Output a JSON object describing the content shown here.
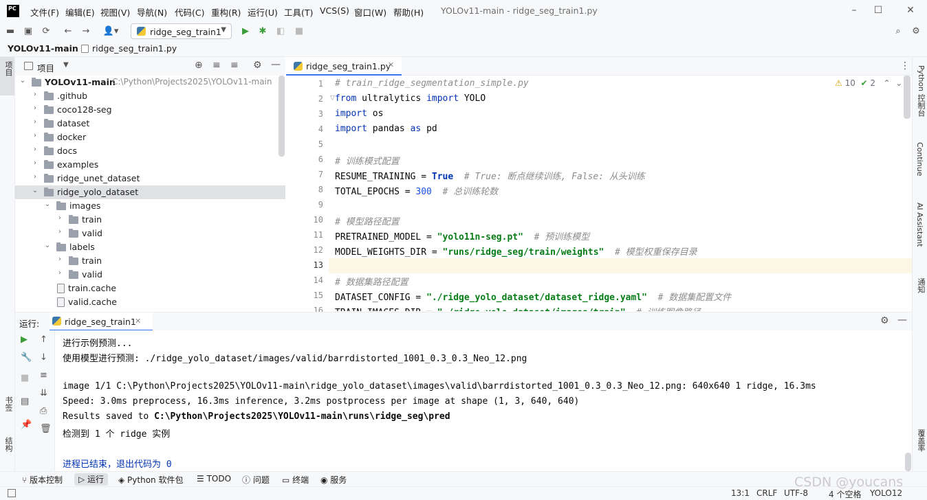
{
  "titlebar": {
    "logo_text": "PC",
    "menus": [
      "文件(F)",
      "编辑(E)",
      "视图(V)",
      "导航(N)",
      "代码(C)",
      "重构(R)",
      "运行(U)",
      "工具(T)",
      "VCS(S)",
      "窗口(W)",
      "帮助(H)"
    ],
    "window_title": "YOLOv11-main - ridge_seg_train1.py",
    "controls": [
      "–",
      "☐",
      "✕"
    ]
  },
  "toolbar": {
    "run_config": "ridge_seg_train1"
  },
  "breadcrumb": {
    "project": "YOLOv11-main",
    "file": "ridge_seg_train1.py"
  },
  "left_strip": {
    "project_label": "项目",
    "bookmarks_label": "书签",
    "structure_label": "结构"
  },
  "right_strip": {
    "python_console": "Python 控制台",
    "continue": "Continue",
    "ai_assistant": "AI Assistant",
    "notifications": "通知",
    "coverage": "覆盖率"
  },
  "project_panel": {
    "title": "项目",
    "root_name": "YOLOv11-main",
    "root_path": "C:\\Python\\Projects2025\\YOLOv11-main",
    "items": [
      {
        "name": ".github",
        "depth": 1,
        "type": "folder",
        "expanded": false
      },
      {
        "name": "coco128-seg",
        "depth": 1,
        "type": "folder",
        "expanded": false
      },
      {
        "name": "dataset",
        "depth": 1,
        "type": "folder",
        "expanded": false
      },
      {
        "name": "docker",
        "depth": 1,
        "type": "folder",
        "expanded": false
      },
      {
        "name": "docs",
        "depth": 1,
        "type": "folder",
        "expanded": false
      },
      {
        "name": "examples",
        "depth": 1,
        "type": "folder",
        "expanded": false
      },
      {
        "name": "ridge_unet_dataset",
        "depth": 1,
        "type": "folder",
        "expanded": false
      },
      {
        "name": "ridge_yolo_dataset",
        "depth": 1,
        "type": "folder",
        "expanded": true,
        "selected": true
      },
      {
        "name": "images",
        "depth": 2,
        "type": "folder",
        "expanded": true
      },
      {
        "name": "train",
        "depth": 3,
        "type": "folder",
        "expanded": false
      },
      {
        "name": "valid",
        "depth": 3,
        "type": "folder",
        "expanded": false
      },
      {
        "name": "labels",
        "depth": 2,
        "type": "folder",
        "expanded": true
      },
      {
        "name": "train",
        "depth": 3,
        "type": "folder",
        "expanded": false
      },
      {
        "name": "valid",
        "depth": 3,
        "type": "folder",
        "expanded": false
      },
      {
        "name": "train.cache",
        "depth": 3,
        "type": "file"
      },
      {
        "name": "valid.cache",
        "depth": 3,
        "type": "file"
      }
    ]
  },
  "editor": {
    "tab_label": "ridge_seg_train1.py",
    "warnings": "10",
    "checks": "2",
    "current_line": 13,
    "lines": [
      [
        {
          "t": "# train_ridge_segmentation_simple.py",
          "c": "cm"
        }
      ],
      [
        {
          "t": "from",
          "c": "kw"
        },
        {
          "t": " ultralytics ",
          "c": ""
        },
        {
          "t": "import",
          "c": "kw"
        },
        {
          "t": " YOLO",
          "c": ""
        }
      ],
      [
        {
          "t": "import",
          "c": "kw"
        },
        {
          "t": " os",
          "c": ""
        }
      ],
      [
        {
          "t": "import",
          "c": "kw"
        },
        {
          "t": " pandas ",
          "c": ""
        },
        {
          "t": "as",
          "c": "kw"
        },
        {
          "t": " pd",
          "c": ""
        }
      ],
      [],
      [
        {
          "t": "# 训练模式配置",
          "c": "cm"
        }
      ],
      [
        {
          "t": "RESUME_TRAINING = ",
          "c": ""
        },
        {
          "t": "True",
          "c": "bool"
        },
        {
          "t": "  # True: 断点继续训练, False: 从头训练",
          "c": "cm"
        }
      ],
      [
        {
          "t": "TOTAL_EPOCHS = ",
          "c": ""
        },
        {
          "t": "300",
          "c": "num"
        },
        {
          "t": "  # 总训练轮数",
          "c": "cm"
        }
      ],
      [],
      [
        {
          "t": "# 模型路径配置",
          "c": "cm"
        }
      ],
      [
        {
          "t": "PRETRAINED_MODEL = ",
          "c": ""
        },
        {
          "t": "\"yolo11n-seg.pt\"",
          "c": "str"
        },
        {
          "t": "  # 预训练模型",
          "c": "cm"
        }
      ],
      [
        {
          "t": "MODEL_WEIGHTS_DIR = ",
          "c": ""
        },
        {
          "t": "\"runs/ridge_seg/train/weights\"",
          "c": "str"
        },
        {
          "t": "  # 模型权重保存目录",
          "c": "cm"
        }
      ],
      [],
      [
        {
          "t": "# 数据集路径配置",
          "c": "cm"
        }
      ],
      [
        {
          "t": "DATASET_CONFIG = ",
          "c": ""
        },
        {
          "t": "\"./ridge_yolo_dataset/dataset_ridge.yaml\"",
          "c": "str"
        },
        {
          "t": "  # 数据集配置文件",
          "c": "cm"
        }
      ],
      [
        {
          "t": "TRAIN_IMAGES_DIR = ",
          "c": ""
        },
        {
          "t": "\"./ridge_yolo_dataset/images/train\"",
          "c": "str"
        },
        {
          "t": "  # 训练图像路径",
          "c": "cm"
        }
      ]
    ]
  },
  "run_panel": {
    "label": "运行:",
    "tab_label": "ridge_seg_train1",
    "output": [
      {
        "t": "进行示例预测...",
        "b": false,
        "c": ""
      },
      {
        "t": "使用模型进行预测: ./ridge_yolo_dataset/images/valid/barrdistorted_1001_0.3_0.3_Neo_12.png",
        "b": false,
        "c": ""
      },
      {
        "t": "",
        "b": false,
        "c": ""
      },
      {
        "t": "image 1/1 C:\\Python\\Projects2025\\YOLOv11-main\\ridge_yolo_dataset\\images\\valid\\barrdistorted_1001_0.3_0.3_Neo_12.png: 640x640 1 ridge, 16.3ms",
        "b": false,
        "c": ""
      },
      {
        "t": "Speed: 3.0ms preprocess, 16.3ms inference, 3.2ms postprocess per image at shape (1, 3, 640, 640)",
        "b": false,
        "c": ""
      },
      {
        "t": "Results saved to ",
        "b2": "C:\\Python\\Projects2025\\YOLOv11-main\\runs\\ridge_seg\\pred",
        "b": false,
        "c": ""
      },
      {
        "t": "检测到 1 个 ridge 实例",
        "b": false,
        "c": ""
      },
      {
        "t": "",
        "b": false,
        "c": ""
      },
      {
        "t": "进程已结束，退出代码为 0",
        "b": false,
        "c": "exit"
      }
    ]
  },
  "tool_windows": [
    "版本控制",
    "运行",
    "Python 软件包",
    "TODO",
    "问题",
    "终端",
    "服务"
  ],
  "status": {
    "position": "13:1",
    "line_sep": "CRLF",
    "encoding": "UTF-8",
    "indent": "4 个空格",
    "interpreter": "YOLO12"
  },
  "watermark": "CSDN @youcans"
}
